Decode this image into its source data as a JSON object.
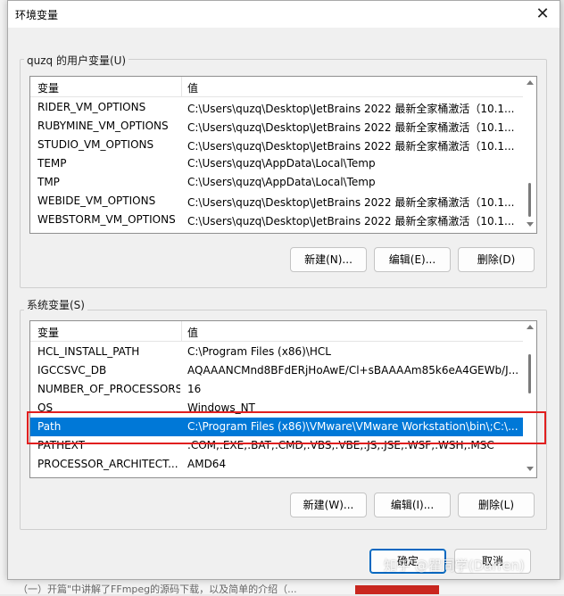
{
  "dialog": {
    "title": "环境变量",
    "close": "✕"
  },
  "user_vars": {
    "group_label": "quzq 的用户变量(U)",
    "col_var": "变量",
    "col_val": "值",
    "rows": [
      {
        "name": "RIDER_VM_OPTIONS",
        "value": "C:\\Users\\quzq\\Desktop\\JetBrains  2022 最新全家桶激活（10.1..."
      },
      {
        "name": "RUBYMINE_VM_OPTIONS",
        "value": "C:\\Users\\quzq\\Desktop\\JetBrains  2022 最新全家桶激活（10.1..."
      },
      {
        "name": "STUDIO_VM_OPTIONS",
        "value": "C:\\Users\\quzq\\Desktop\\JetBrains  2022 最新全家桶激活（10.1..."
      },
      {
        "name": "TEMP",
        "value": "C:\\Users\\quzq\\AppData\\Local\\Temp"
      },
      {
        "name": "TMP",
        "value": "C:\\Users\\quzq\\AppData\\Local\\Temp"
      },
      {
        "name": "WEBIDE_VM_OPTIONS",
        "value": "C:\\Users\\quzq\\Desktop\\JetBrains  2022 最新全家桶激活（10.1..."
      },
      {
        "name": "WEBSTORM_VM_OPTIONS",
        "value": "C:\\Users\\quzq\\Desktop\\JetBrains  2022 最新全家桶激活（10.1..."
      }
    ],
    "new_button": "新建(N)...",
    "edit_button": "编辑(E)...",
    "delete_button": "删除(D)"
  },
  "system_vars": {
    "group_label": "系统变量(S)",
    "col_var": "变量",
    "col_val": "值",
    "rows": [
      {
        "name": "HCL_INSTALL_PATH",
        "value": "C:\\Program Files (x86)\\HCL"
      },
      {
        "name": "IGCCSVC_DB",
        "value": "AQAAANCMnd8BFdERjHoAwE/Cl+sBAAAAm85k6eA4GEWb/J..."
      },
      {
        "name": "NUMBER_OF_PROCESSORS",
        "value": "16"
      },
      {
        "name": "OS",
        "value": "Windows_NT"
      },
      {
        "name": "Path",
        "value": "C:\\Program Files (x86)\\VMware\\VMware Workstation\\bin\\;C:\\...",
        "selected": true
      },
      {
        "name": "PATHEXT",
        "value": ".COM;.EXE;.BAT;.CMD;.VBS;.VBE;.JS;.JSE;.WSF;.WSH;.MSC"
      },
      {
        "name": "PROCESSOR_ARCHITECT...",
        "value": "AMD64"
      }
    ],
    "new_button": "新建(W)...",
    "edit_button": "编辑(I)...",
    "delete_button": "删除(L)"
  },
  "footer": {
    "ok_button": "确定",
    "cancel_button": "取消"
  },
  "watermark": "知乎 @瞿同学(Darren)",
  "background": {
    "bottom_text": "（一）开篇\"中讲解了FFmpeg的源码下载，以及简单的介绍（..."
  },
  "colors": {
    "selection": "#0078d7",
    "highlight_border": "#e11f1f"
  }
}
